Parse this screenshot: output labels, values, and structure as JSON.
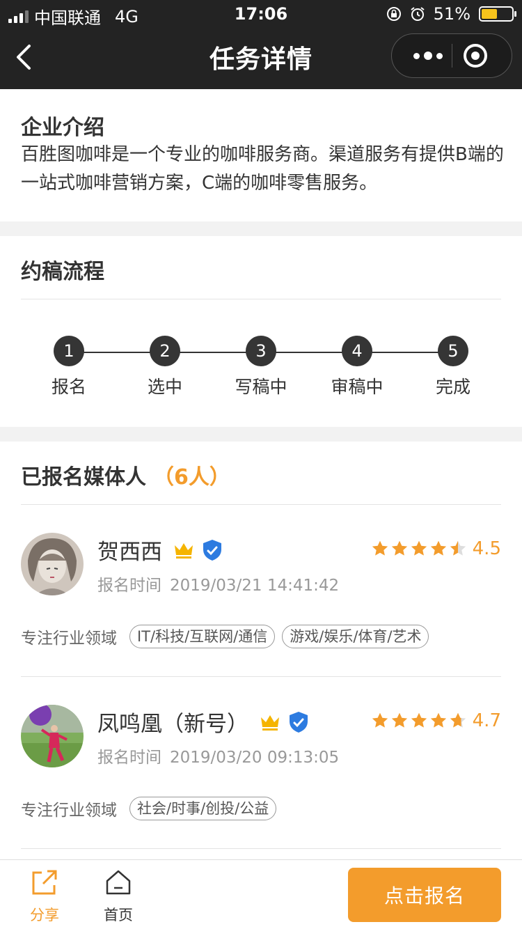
{
  "status_bar": {
    "carrier": "中国联通",
    "network": "4G",
    "time": "17:06",
    "battery": "51%",
    "battery_level": 0.51
  },
  "nav": {
    "title": "任务详情"
  },
  "intro": {
    "title": "企业介绍",
    "text": "百胜图咖啡是一个专业的咖啡服务商。渠道服务有提供B端的一站式咖啡营销方案，C端的咖啡零售服务。"
  },
  "flow": {
    "title": "约稿流程",
    "steps": [
      {
        "num": "1",
        "label": "报名"
      },
      {
        "num": "2",
        "label": "选中"
      },
      {
        "num": "3",
        "label": "写稿中"
      },
      {
        "num": "4",
        "label": "审稿中"
      },
      {
        "num": "5",
        "label": "完成"
      }
    ]
  },
  "media": {
    "title": "已报名媒体人",
    "count": "（6人）",
    "time_label": "报名时间",
    "field_label": "专注行业领域",
    "people": [
      {
        "name": "贺西西",
        "rating": "4.5",
        "rating_value": 4.5,
        "signup_time": "2019/03/21 14:41:42",
        "tags": [
          "IT/科技/互联网/通信",
          "游戏/娱乐/体育/艺术"
        ]
      },
      {
        "name": "凤鸣凰（新号）",
        "rating": "4.7",
        "rating_value": 4.7,
        "signup_time": "2019/03/20 09:13:05",
        "tags": [
          "社会/时事/创投/公益"
        ]
      }
    ]
  },
  "bottom": {
    "share": "分享",
    "home": "首页",
    "apply": "点击报名"
  },
  "colors": {
    "accent": "#f39c2c",
    "topbar": "#232323",
    "badge_blue": "#2d7be0"
  }
}
